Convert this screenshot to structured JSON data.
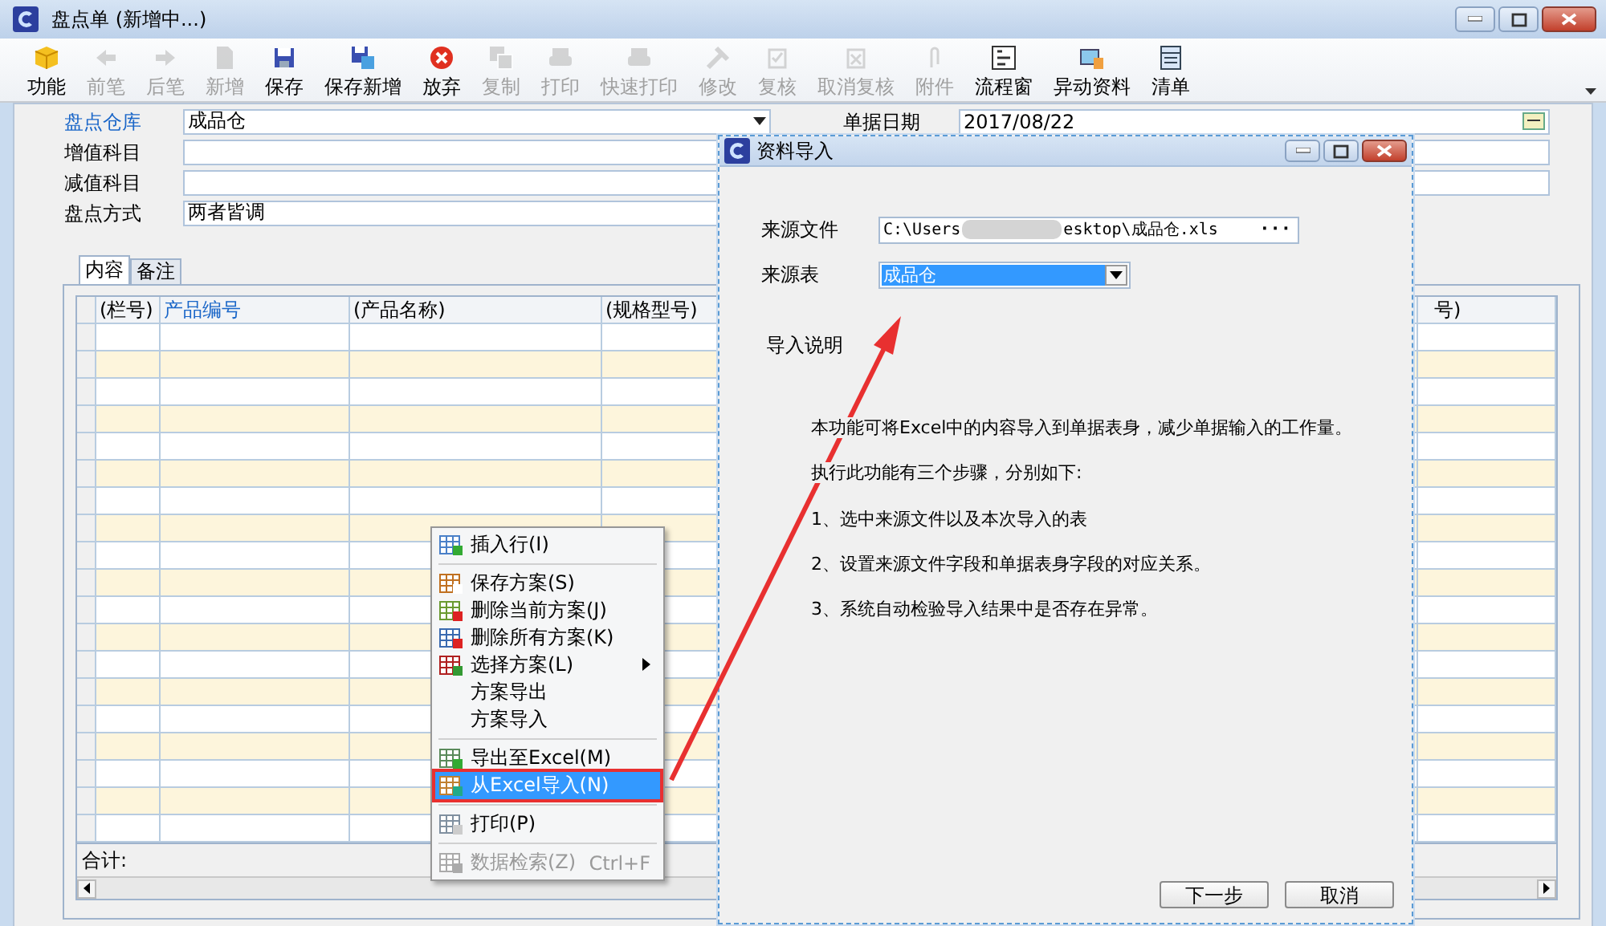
{
  "window": {
    "title": "盘点单 (新增中...)"
  },
  "toolbar": [
    {
      "label": "功能",
      "disabled": false
    },
    {
      "label": "前笔",
      "disabled": true
    },
    {
      "label": "后笔",
      "disabled": true
    },
    {
      "label": "新增",
      "disabled": true
    },
    {
      "label": "保存",
      "disabled": false
    },
    {
      "label": "保存新增",
      "disabled": false
    },
    {
      "label": "放弃",
      "disabled": false
    },
    {
      "label": "复制",
      "disabled": true
    },
    {
      "label": "打印",
      "disabled": true
    },
    {
      "label": "快速打印",
      "disabled": true
    },
    {
      "label": "修改",
      "disabled": true
    },
    {
      "label": "复核",
      "disabled": true
    },
    {
      "label": "取消复核",
      "disabled": true
    },
    {
      "label": "附件",
      "disabled": true
    },
    {
      "label": "流程窗",
      "disabled": false
    },
    {
      "label": "异动资料",
      "disabled": false
    },
    {
      "label": "清单",
      "disabled": false
    }
  ],
  "form": {
    "rows": [
      [
        {
          "label": "盘点仓库",
          "value": "成品仓",
          "kind": "combo",
          "required": true
        },
        {
          "label": "单据日期",
          "value": "2017/08/22",
          "kind": "date",
          "required": false
        }
      ],
      [
        {
          "label": "增值科目",
          "kind": "text",
          "required": false
        }
      ],
      [
        {
          "label": "减值科目",
          "kind": "text",
          "required": false
        }
      ],
      [
        {
          "label": "盘点方式",
          "value": "两者皆调",
          "kind": "short",
          "required": false
        }
      ]
    ]
  },
  "tabs": [
    {
      "label": "内容",
      "selected": true
    },
    {
      "label": "备注",
      "selected": false
    }
  ],
  "grid": {
    "columns": [
      {
        "label": "(栏号)",
        "required": false
      },
      {
        "label": "产品编号",
        "required": true
      },
      {
        "label": "(产品名称)",
        "required": false
      },
      {
        "label": "(规格型号)",
        "required": false
      },
      {
        "label": "号)",
        "required": false
      }
    ],
    "footer": "合计:"
  },
  "context_menu": {
    "items": [
      {
        "kind": "item",
        "label": "插入行(I)",
        "selected": false,
        "disabled": false
      },
      {
        "kind": "separator"
      },
      {
        "kind": "item",
        "label": "保存方案(S)",
        "selected": false,
        "disabled": false
      },
      {
        "kind": "item",
        "label": "删除当前方案(J)",
        "selected": false,
        "disabled": false
      },
      {
        "kind": "item",
        "label": "删除所有方案(K)",
        "selected": false,
        "disabled": false
      },
      {
        "kind": "submenu",
        "label": "选择方案(L)",
        "selected": false,
        "disabled": false
      },
      {
        "kind": "item",
        "label": "方案导出",
        "selected": false,
        "disabled": false
      },
      {
        "kind": "item",
        "label": "方案导入",
        "selected": false,
        "disabled": false
      },
      {
        "kind": "separator"
      },
      {
        "kind": "item",
        "label": "导出至Excel(M)",
        "selected": false,
        "disabled": false
      },
      {
        "kind": "item",
        "label": "从Excel导入(N)",
        "selected": true,
        "disabled": false
      },
      {
        "kind": "separator"
      },
      {
        "kind": "item",
        "label": "打印(P)",
        "selected": false,
        "disabled": false
      },
      {
        "kind": "separator"
      },
      {
        "kind": "item",
        "label": "数据检索(Z)",
        "shortcut": "Ctrl+F",
        "selected": false,
        "disabled": true
      }
    ]
  },
  "dialog": {
    "title": "资料导入",
    "source_file": {
      "label": "来源文件",
      "value_start": "C:\\Users",
      "value_end": "esktop\\成品仓.xls",
      "button": "···"
    },
    "source_sheet": {
      "label": "来源表",
      "value": "成品仓"
    },
    "notes_title": "导入说明",
    "notes": [
      "本功能可将Excel中的内容导入到单据表身，减少单据输入的工作量。",
      "执行此功能有三个步骤，分别如下:",
      "1、选中来源文件以及本次导入的表",
      "2、设置来源文件字段和单据表身字段的对应关系。",
      "3、系统自动检验导入结果中是否存在异常。"
    ],
    "buttons": [
      "下一步",
      "取消"
    ]
  }
}
